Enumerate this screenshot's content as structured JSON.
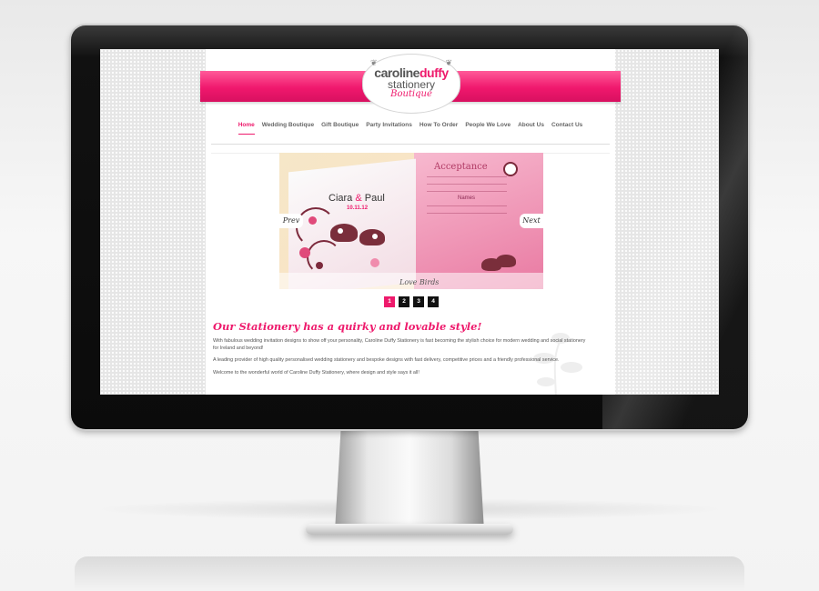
{
  "logo": {
    "line1_part1": "caroline",
    "line1_part2": "duffy",
    "line2": "stationery",
    "line3": "Boutique"
  },
  "nav": {
    "items": [
      {
        "label": "Home",
        "active": true
      },
      {
        "label": "Wedding Boutique"
      },
      {
        "label": "Gift Boutique"
      },
      {
        "label": "Party Invitations"
      },
      {
        "label": "How To Order"
      },
      {
        "label": "People We Love"
      },
      {
        "label": "About Us"
      },
      {
        "label": "Contact Us"
      }
    ]
  },
  "slideshow": {
    "prev_label": "Prev",
    "next_label": "Next",
    "caption": "Love Birds",
    "card": {
      "names_a": "Ciara",
      "amp": "&",
      "names_b": "Paul",
      "date": "10.11.12",
      "acceptance_title": "Acceptance",
      "names_label": "Names"
    }
  },
  "pager": [
    "1",
    "2",
    "3",
    "4"
  ],
  "pager_active": "1",
  "content": {
    "tagline": "Our Stationery has a quirky and lovable style!",
    "para1": "With fabulous wedding invitation designs to show off your personality, Caroline Duffy Stationery is fast becoming the stylish choice for modern wedding and social stationery for Ireland and beyond!",
    "para2": "A leading provider of high quality personalised wedding stationery and bespoke designs with fast delivery, competitive prices and a friendly professional service.",
    "para3": "Welcome to the wonderful world of Caroline Duffy Stationery, where design and style says it all!"
  },
  "colors": {
    "accent": "#ee1a6c",
    "bezel": "#0b0b0b",
    "page_bg": "#ffffff"
  }
}
